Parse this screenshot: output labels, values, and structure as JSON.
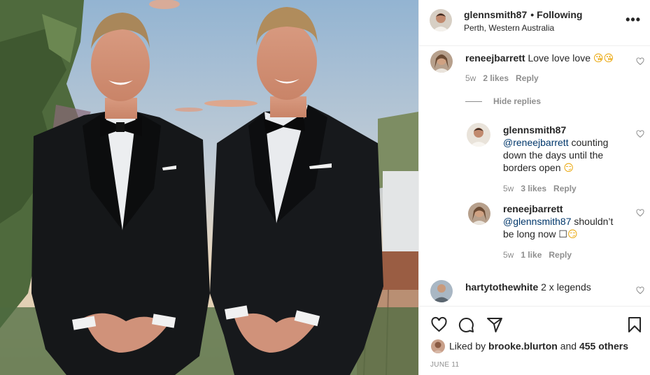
{
  "post": {
    "username": "glennsmith87",
    "separator": "•",
    "follow_label": "Following",
    "location": "Perth, Western Australia",
    "more_label": "•••"
  },
  "comments": [
    {
      "username": "reneejbarrett",
      "text": "Love love love",
      "emoji": "😘😘",
      "age": "5w",
      "likes": "2 likes",
      "reply_label": "Reply"
    },
    {
      "username": "glennsmith87",
      "mention": "@reneejbarrett",
      "text": " counting down the days until the borders open",
      "emoji": "😏",
      "age": "5w",
      "likes": "3 likes",
      "reply_label": "Reply"
    },
    {
      "username": "reneejbarrett",
      "mention": "@glennsmith87",
      "text": " shouldn’t be long now ☐",
      "emoji": "😏",
      "age": "5w",
      "likes": "1 like",
      "reply_label": "Reply"
    },
    {
      "username": "hartytothewhite",
      "text": "2 x legends"
    }
  ],
  "hide_replies_label": "Hide replies",
  "likes": {
    "prefix": "Liked by",
    "liker": "brooke.blurton",
    "connector": "and",
    "others": "455 others"
  },
  "date": "JUNE 11",
  "icons": [
    "heart-icon",
    "comment-icon",
    "share-icon",
    "bookmark-icon",
    "more-icon"
  ],
  "colors": {
    "text": "#262626",
    "muted": "#8e8e8e",
    "mention": "#00376b",
    "border": "#efefef"
  }
}
